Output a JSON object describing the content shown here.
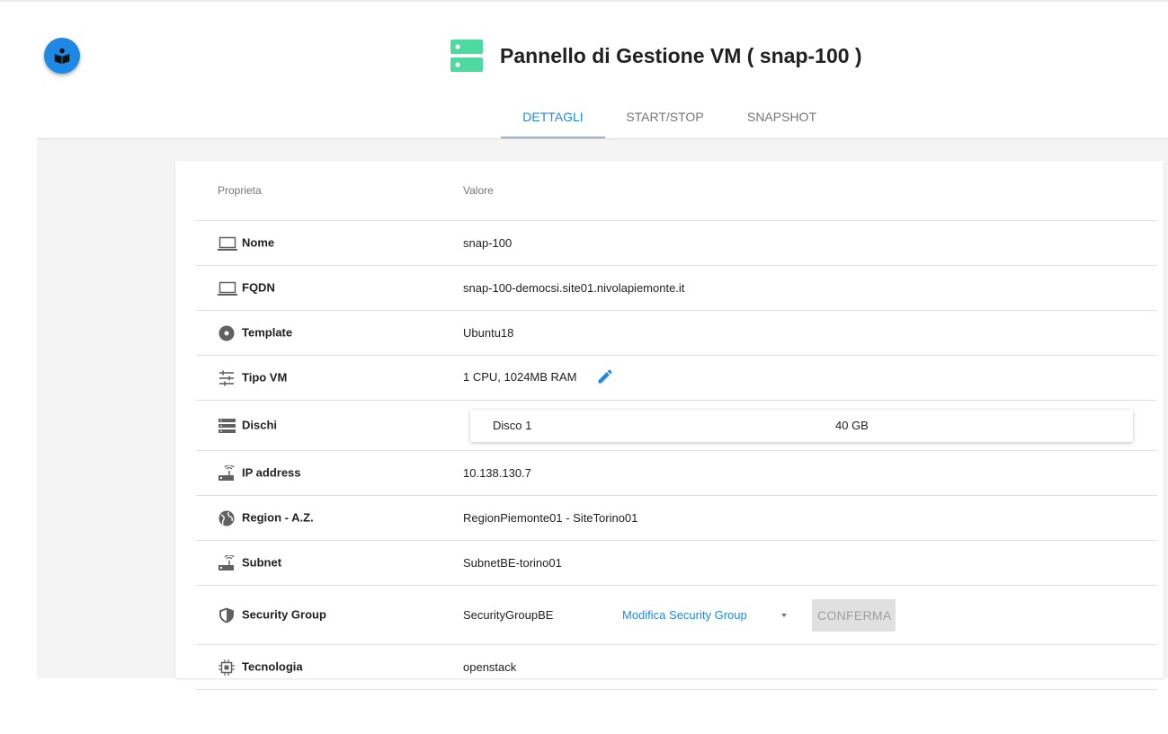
{
  "header": {
    "title": "Pannello di Gestione VM ( snap-100 )"
  },
  "tabs": [
    {
      "label": "DETTAGLI",
      "active": true
    },
    {
      "label": "START/STOP",
      "active": false
    },
    {
      "label": "SNAPSHOT",
      "active": false
    }
  ],
  "table": {
    "columns": [
      "Proprieta",
      "Valore"
    ],
    "rows": {
      "nome": {
        "label": "Nome",
        "value": "snap-100",
        "icon": "laptop-icon"
      },
      "fqdn": {
        "label": "FQDN",
        "value": "snap-100-democsi.site01.nivolapiemonte.it",
        "icon": "laptop-icon"
      },
      "template": {
        "label": "Template",
        "value": "Ubuntu18",
        "icon": "disc-icon"
      },
      "tipo_vm": {
        "label": "Tipo VM",
        "value": "1 CPU, 1024MB RAM",
        "icon": "tune-icon"
      },
      "dischi": {
        "label": "Dischi",
        "icon": "storage-icon",
        "disks": [
          {
            "name": "Disco 1",
            "size": "40 GB"
          }
        ]
      },
      "ip": {
        "label": "IP address",
        "value": "10.138.130.7",
        "icon": "router-icon"
      },
      "region": {
        "label": "Region - A.Z.",
        "value": "RegionPiemonte01 - SiteTorino01",
        "icon": "globe-icon"
      },
      "subnet": {
        "label": "Subnet",
        "value": "SubnetBE-torino01",
        "icon": "router-icon"
      },
      "security_group": {
        "label": "Security Group",
        "value": "SecurityGroupBE",
        "select_label": "Modifica Security Group",
        "confirm_label": "CONFERMA",
        "icon": "shield-icon"
      },
      "tecnologia": {
        "label": "Tecnologia",
        "value": "openstack",
        "icon": "chip-icon"
      }
    }
  },
  "colors": {
    "accent": "#1e88e5",
    "server_icon": "#4dd9a0",
    "background": "#f4f4f4"
  }
}
